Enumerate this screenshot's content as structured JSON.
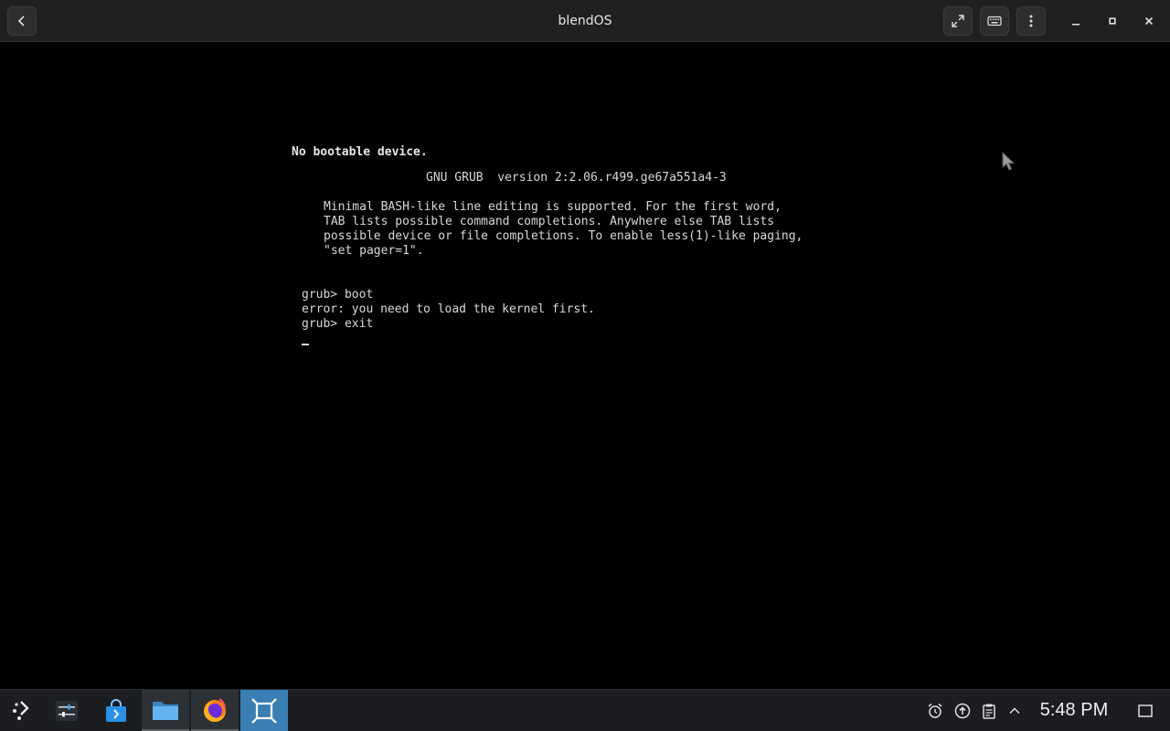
{
  "window": {
    "title": "blendOS",
    "toolbar_icons": [
      "back-arrow-icon",
      "fullscreen-icon",
      "keyboard-icon",
      "kebab-menu-icon",
      "minimize-icon",
      "maximize-icon",
      "close-icon"
    ]
  },
  "console": {
    "header": "No bootable device.",
    "grub_banner": "GNU GRUB  version 2:2.06.r499.ge67a551a4-3",
    "help_lines": [
      "Minimal BASH-like line editing is supported. For the first word,",
      "TAB lists possible command completions. Anywhere else TAB lists",
      "possible device or file completions. To enable less(1)-like paging,",
      "\"set pager=1\"."
    ],
    "session": [
      "grub> boot",
      "error: you need to load the kernel first.",
      "grub> exit"
    ]
  },
  "taskbar": {
    "launcher_icon": "app-launcher-icon",
    "apps": [
      {
        "name": "settings-mixer",
        "icon": "sliders-icon",
        "state": "pinned"
      },
      {
        "name": "app-store",
        "icon": "store-bag-icon",
        "state": "pinned"
      },
      {
        "name": "file-manager",
        "icon": "folder-icon",
        "state": "running"
      },
      {
        "name": "firefox",
        "icon": "firefox-icon",
        "state": "running"
      },
      {
        "name": "virtual-machine",
        "icon": "vm-frame-icon",
        "state": "active"
      }
    ],
    "tray_icons": [
      "alarm-icon",
      "updates-icon",
      "clipboard-icon",
      "expand-tray-icon"
    ],
    "clock": "5:48 PM",
    "show_desktop_icon": "show-desktop-icon"
  },
  "colors": {
    "titlebar_bg": "#202020",
    "console_bg": "#000000",
    "console_fg": "#d8d8d8",
    "taskbar_bg": "#1b1d20",
    "active_task": "#3a7fb4"
  }
}
